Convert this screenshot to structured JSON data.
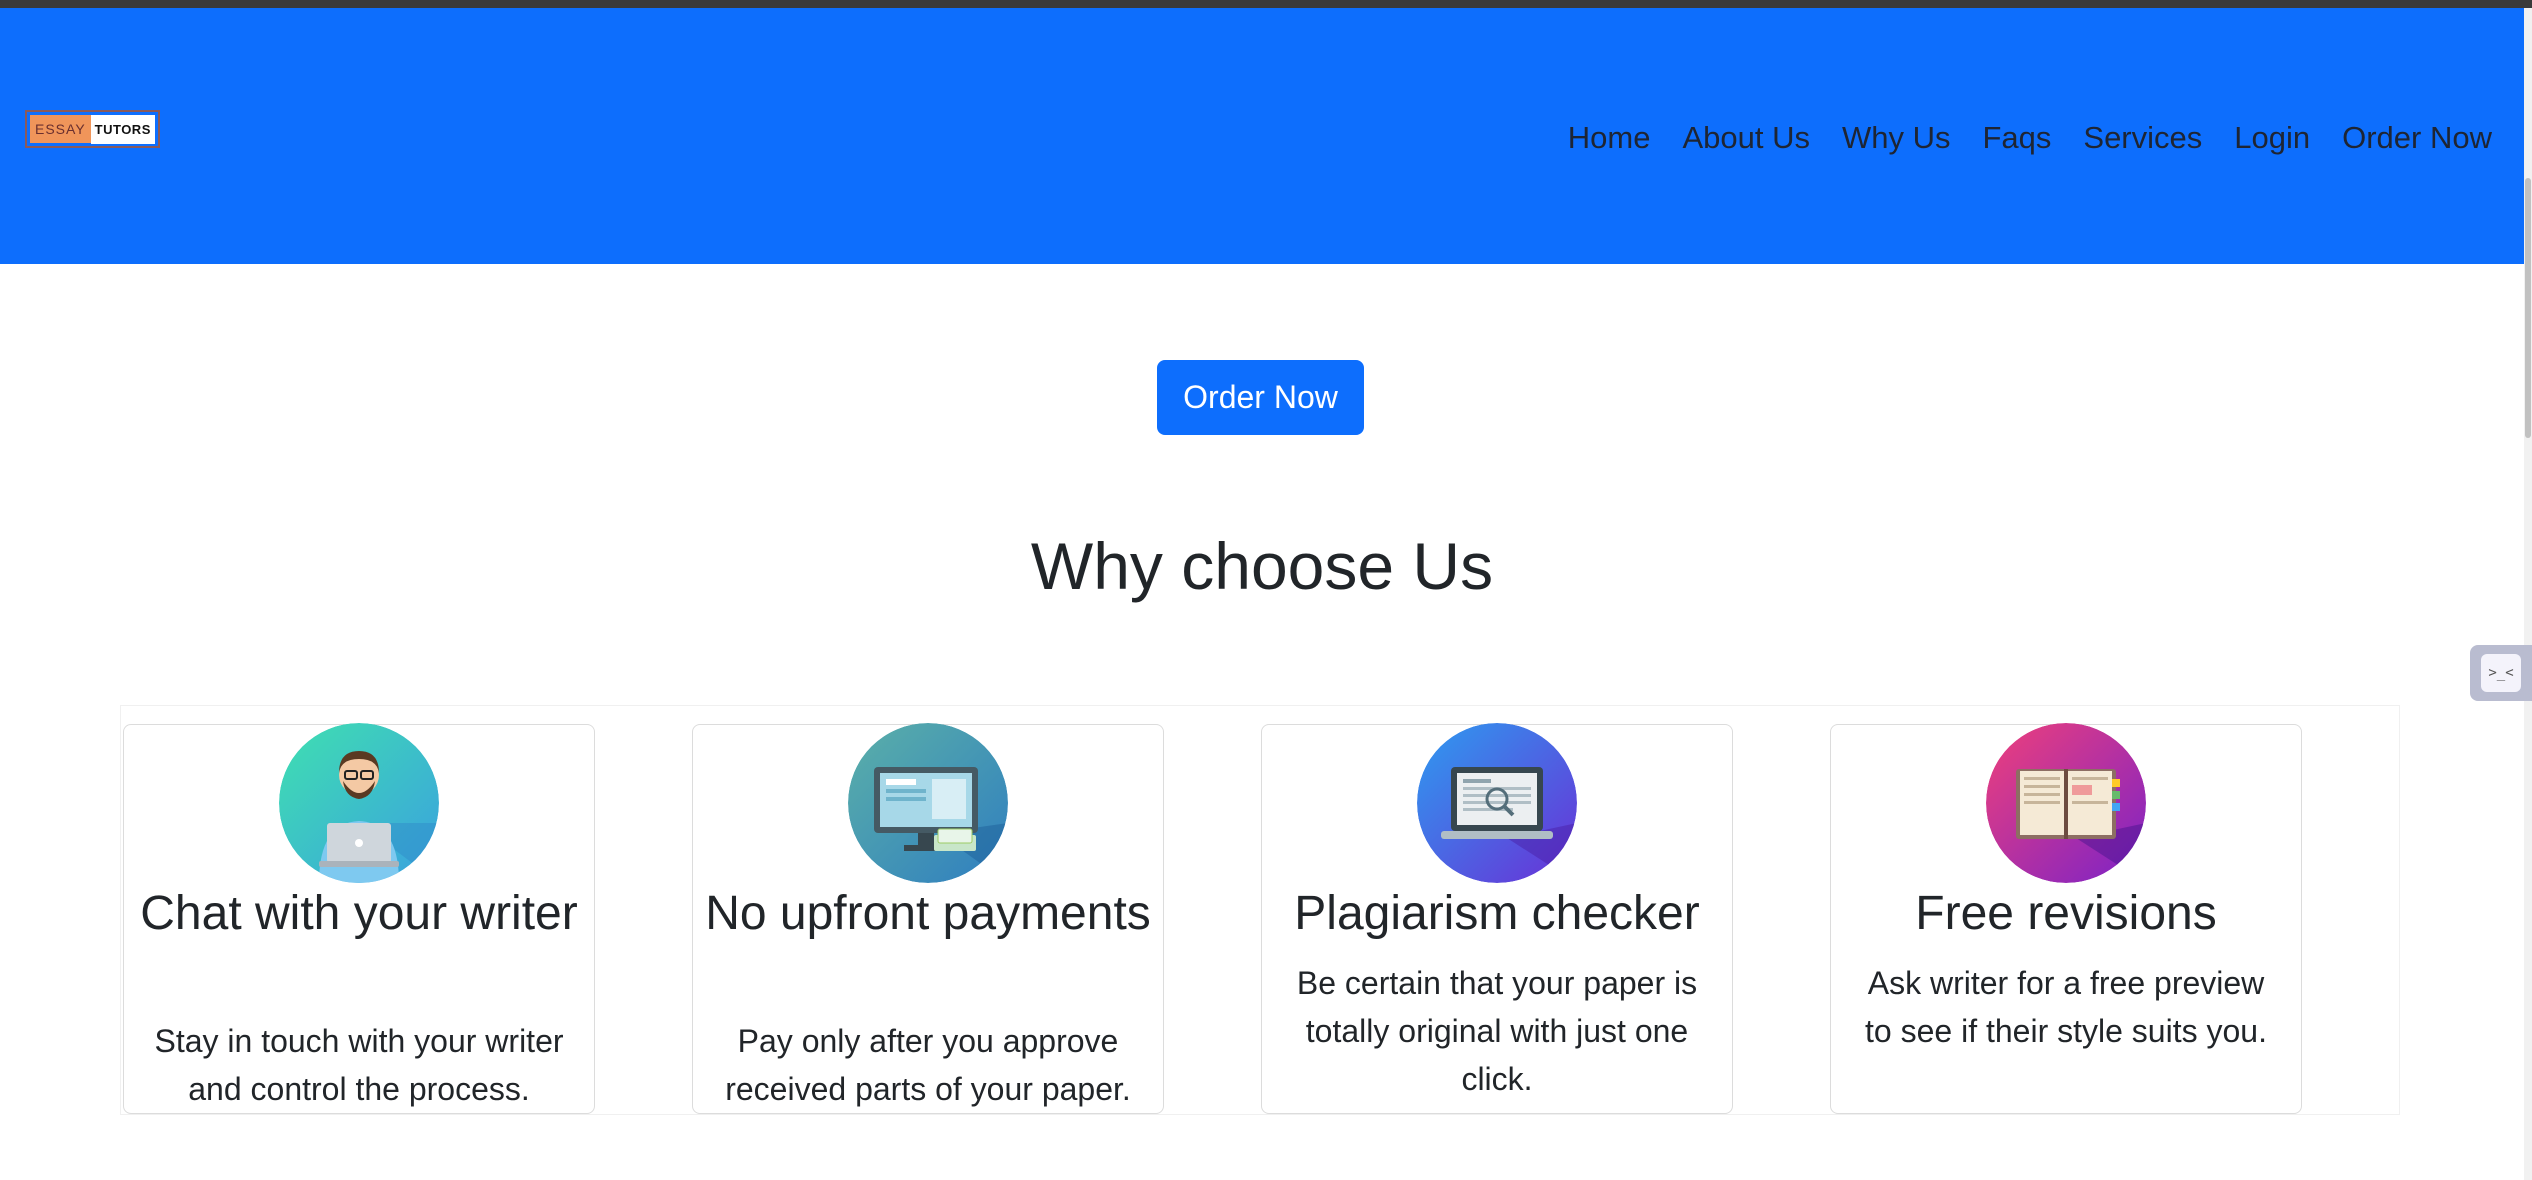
{
  "brand": {
    "logo_part1": "ESSAY",
    "logo_part2": "TUTORS"
  },
  "nav": {
    "items": [
      "Home",
      "About Us",
      "Why Us",
      "Faqs",
      "Services",
      "Login",
      "Order Now"
    ]
  },
  "hero": {
    "order_button": "Order Now"
  },
  "why": {
    "title": "Why choose Us",
    "cards": [
      {
        "icon": "writer-laptop-icon",
        "title": "Chat with your writer",
        "text": "Stay in touch with your writer and control the process."
      },
      {
        "icon": "monitor-payment-icon",
        "title": "No upfront payments",
        "text": "Pay only after you approve received parts of your paper."
      },
      {
        "icon": "laptop-magnifier-icon",
        "title": "Plagiarism checker",
        "text": "Be certain that your paper is totally original with just one click."
      },
      {
        "icon": "open-book-icon",
        "title": "Free revisions",
        "text": "Ask writer for a free preview to see if their style suits you."
      }
    ]
  },
  "chat_widget": {
    "glyph": ">_<"
  },
  "colors": {
    "primary": "#0d6efd",
    "text": "#212529"
  }
}
